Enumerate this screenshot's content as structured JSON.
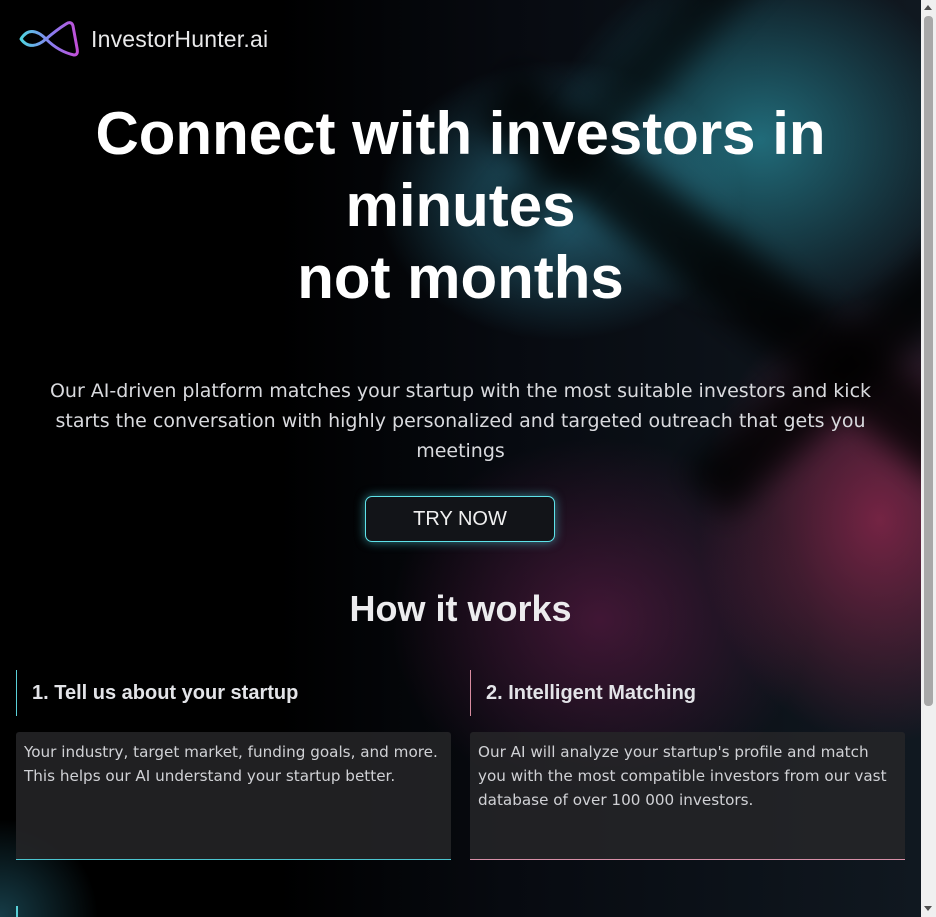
{
  "brand": {
    "name": "InvestorHunter.ai",
    "logo_icon": "infinity-loop-logo-icon",
    "accent_cyan": "#5fe3ea",
    "accent_pink": "#d88ca0"
  },
  "hero": {
    "title_line1": "Connect with investors in",
    "title_line2": "minutes",
    "title_line3": "not months",
    "subtitle": "Our AI-driven platform matches your startup with the most suitable investors and kick starts the conversation with highly personalized and targeted outreach that gets you meetings",
    "cta_label": "TRY NOW"
  },
  "how_it_works": {
    "heading": "How it works",
    "steps": [
      {
        "title": "1. Tell us about your startup",
        "description": "Your industry, target market, funding goals, and more. This helps our AI understand your startup better."
      },
      {
        "title": "2. Intelligent Matching",
        "description": "Our AI will analyze your startup's profile and match you with the most compatible investors from our vast database of over 100 000 investors."
      }
    ]
  }
}
